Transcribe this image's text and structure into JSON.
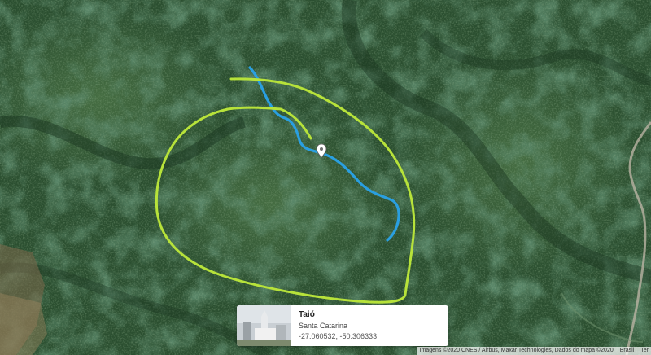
{
  "place_card": {
    "title": "Taió",
    "region": "Santa Catarina",
    "coordinates": "-27.060532, -50.306333",
    "directions_icon": "directions-icon",
    "close_label": "×"
  },
  "attribution": {
    "imagery": "Imagens ©2020 CNES / Airbus, Maxar Technologies, Dados do mapa ©2020",
    "country": "Brasil",
    "terms": "Ter"
  },
  "colors": {
    "forest_dark": "#1d3a24",
    "forest_light": "#3f6b3c",
    "annotation_green": "#b7e23a",
    "river_blue": "#2a9fe0",
    "directions_blue": "#4a8ae6"
  }
}
